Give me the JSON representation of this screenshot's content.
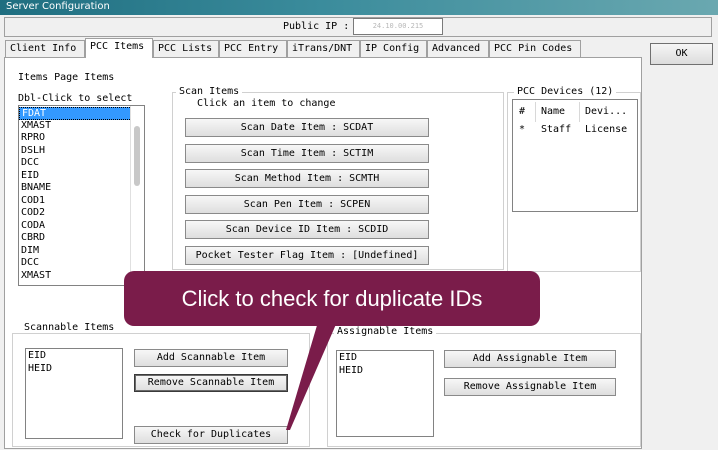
{
  "window": {
    "title": "Server Configuration"
  },
  "public_ip": {
    "label": "Public IP :",
    "value": "24.10.00.215"
  },
  "tabs": [
    {
      "label": "Client Info"
    },
    {
      "label": "PCC Items"
    },
    {
      "label": "PCC Lists"
    },
    {
      "label": "PCC Entry"
    },
    {
      "label": "iTrans/DNT"
    },
    {
      "label": "IP Config"
    },
    {
      "label": "Advanced"
    },
    {
      "label": "PCC Pin Codes"
    }
  ],
  "ok_label": "OK",
  "items_page": {
    "title": "Items Page Items",
    "hint": "Dbl-Click to select",
    "items": [
      "FDAT",
      "XMAST",
      "RPRO",
      "DSLH",
      "DCC",
      "EID",
      "BNAME",
      "COD1",
      "COD2",
      "CODA",
      "CBRD",
      "DIM",
      "DCC",
      "XMAST"
    ]
  },
  "scan_items": {
    "legend": "Scan Items",
    "hint": "Click an item to change",
    "buttons": [
      "Scan Date Item : SCDAT",
      "Scan Time Item : SCTIM",
      "Scan Method Item : SCMTH",
      "Scan Pen Item : SCPEN",
      "Scan Device ID Item : SCDID",
      "Pocket Tester Flag Item : [Undefined]"
    ]
  },
  "pcc_devices": {
    "legend": "PCC Devices (12)",
    "headers": [
      "#",
      "Name",
      "Devi..."
    ],
    "rows": [
      [
        "*",
        "Staff",
        "License"
      ]
    ]
  },
  "scannable": {
    "legend": "Scannable Items",
    "items": [
      "EID",
      "HEID"
    ],
    "add_label": "Add Scannable Item",
    "remove_label": "Remove Scannable Item",
    "check_label": "Check for Duplicates"
  },
  "assignable": {
    "legend": "Assignable Items",
    "items": [
      "EID",
      "HEID"
    ],
    "add_label": "Add Assignable Item",
    "remove_label": "Remove Assignable Item"
  },
  "callout": {
    "text": "Click to check for duplicate IDs"
  },
  "colors": {
    "callout": "#7a1c4a",
    "selection": "#3399ff",
    "titlebar": "#1f6e80"
  }
}
